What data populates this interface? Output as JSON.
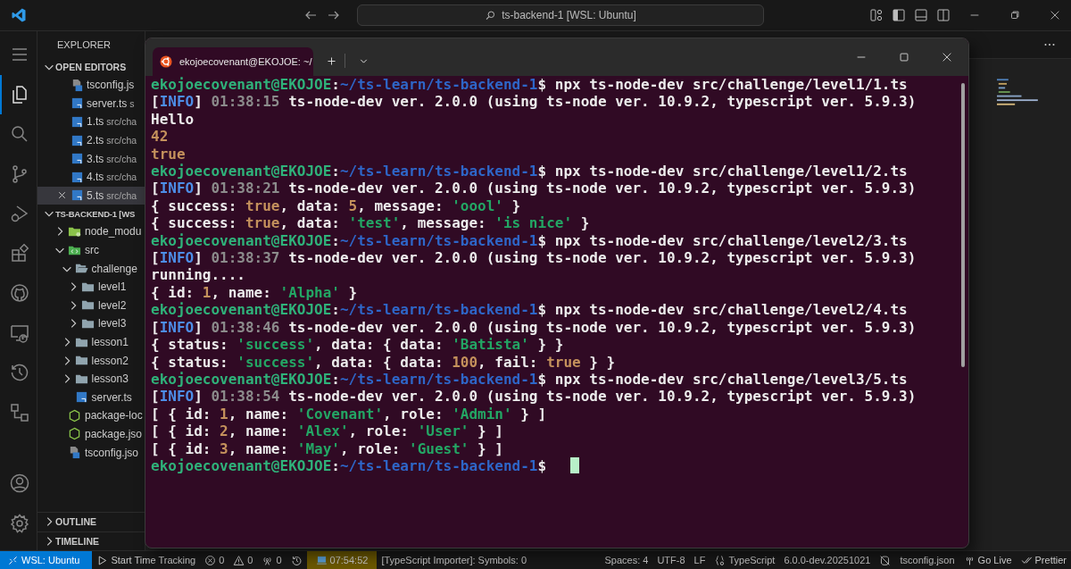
{
  "title_bar": {
    "search": "ts-backend-1 [WSL: Ubuntu]"
  },
  "activity_bar": {
    "top": [
      {
        "kind": "menu",
        "selected": false
      },
      {
        "kind": "explorer",
        "selected": true
      },
      {
        "kind": "search",
        "selected": false
      },
      {
        "kind": "source-control",
        "selected": false
      },
      {
        "kind": "run-debug",
        "selected": false
      },
      {
        "kind": "extensions",
        "selected": false
      },
      {
        "kind": "github",
        "selected": false
      },
      {
        "kind": "remote",
        "selected": false
      },
      {
        "kind": "history",
        "selected": false
      },
      {
        "kind": "tree",
        "selected": false
      }
    ],
    "bottom": [
      {
        "kind": "account",
        "selected": false
      },
      {
        "kind": "settings",
        "selected": false
      }
    ]
  },
  "sidebar": {
    "title": "EXPLORER",
    "open_editors": {
      "label": "OPEN EDITORS",
      "expanded": true,
      "items": [
        {
          "kind": "tsconfig",
          "name": "tsconfig.js",
          "selected": false
        },
        {
          "kind": "ts",
          "name": "server.ts",
          "description": "s",
          "selected": false
        },
        {
          "kind": "ts",
          "name": "1.ts",
          "description": "src/cha",
          "selected": false
        },
        {
          "kind": "ts",
          "name": "2.ts",
          "description": "src/cha",
          "selected": false
        },
        {
          "kind": "ts",
          "name": "3.ts",
          "description": "src/cha",
          "selected": false
        },
        {
          "kind": "ts",
          "name": "4.ts",
          "description": "src/cha",
          "selected": false
        },
        {
          "kind": "ts",
          "name": "5.ts",
          "description": "src/cha",
          "selected": true
        }
      ]
    },
    "workspace": {
      "label": "TS-BACKEND-1 [WS",
      "expanded": true,
      "children": [
        {
          "kind": "node-folder",
          "name": "node_modu",
          "expanded": false
        },
        {
          "kind": "src-folder",
          "name": "src",
          "expanded": true,
          "children": [
            {
              "kind": "folder",
              "name": "challenge",
              "expanded": true,
              "children": [
                {
                  "kind": "folder",
                  "name": "level1",
                  "expanded": false
                },
                {
                  "kind": "folder",
                  "name": "level2",
                  "expanded": false
                },
                {
                  "kind": "folder",
                  "name": "level3",
                  "expanded": false
                }
              ]
            },
            {
              "kind": "folder",
              "name": "lesson1",
              "expanded": false
            },
            {
              "kind": "folder",
              "name": "lesson2",
              "expanded": false
            },
            {
              "kind": "folder",
              "name": "lesson3",
              "expanded": false
            },
            {
              "kind": "ts",
              "name": "server.ts"
            }
          ]
        },
        {
          "kind": "json",
          "name": "package-loc"
        },
        {
          "kind": "json",
          "name": "package.jso"
        },
        {
          "kind": "tsconfig",
          "name": "tsconfig.jso"
        }
      ]
    },
    "outline": {
      "label": "OUTLINE",
      "expanded": false
    },
    "timeline": {
      "label": "TIMELINE",
      "expanded": false
    }
  },
  "terminal": {
    "tab_title": "ekojoecovenant@EKOJOE: ~/",
    "cursor_visible": true,
    "lines": [
      {
        "segments": [
          {
            "kind": "user",
            "text": "ekojoecovenant@EKOJOE"
          },
          {
            "kind": "text",
            "text": ":"
          },
          {
            "kind": "path",
            "text": "~/ts-learn/ts-backend-1"
          },
          {
            "kind": "text",
            "text": "$ npx ts-node-dev src/challenge/level1/1.ts"
          }
        ]
      },
      {
        "segments": [
          {
            "kind": "text",
            "text": "["
          },
          {
            "kind": "info",
            "text": "INFO"
          },
          {
            "kind": "text",
            "text": "] "
          },
          {
            "kind": "time",
            "text": "01:38:15"
          },
          {
            "kind": "text",
            "text": " ts-node-dev ver. 2.0.0 (using ts-node ver. 10.9.2, typescript ver. 5.9.3)"
          }
        ]
      },
      {
        "segments": [
          {
            "kind": "text",
            "text": "Hello"
          }
        ]
      },
      {
        "segments": [
          {
            "kind": "number",
            "text": "42"
          }
        ]
      },
      {
        "segments": [
          {
            "kind": "number",
            "text": "true"
          }
        ]
      },
      {
        "segments": [
          {
            "kind": "user",
            "text": "ekojoecovenant@EKOJOE"
          },
          {
            "kind": "text",
            "text": ":"
          },
          {
            "kind": "path",
            "text": "~/ts-learn/ts-backend-1"
          },
          {
            "kind": "text",
            "text": "$ npx ts-node-dev src/challenge/level1/2.ts"
          }
        ]
      },
      {
        "segments": [
          {
            "kind": "text",
            "text": "["
          },
          {
            "kind": "info",
            "text": "INFO"
          },
          {
            "kind": "text",
            "text": "] "
          },
          {
            "kind": "time",
            "text": "01:38:21"
          },
          {
            "kind": "text",
            "text": " ts-node-dev ver. 2.0.0 (using ts-node ver. 10.9.2, typescript ver. 5.9.3)"
          }
        ]
      },
      {
        "segments": [
          {
            "kind": "text",
            "text": "{ success: "
          },
          {
            "kind": "number",
            "text": "true"
          },
          {
            "kind": "text",
            "text": ", data: "
          },
          {
            "kind": "number",
            "text": "5"
          },
          {
            "kind": "text",
            "text": ", message: "
          },
          {
            "kind": "string",
            "text": "'oool'"
          },
          {
            "kind": "text",
            "text": " }"
          }
        ]
      },
      {
        "segments": [
          {
            "kind": "text",
            "text": "{ success: "
          },
          {
            "kind": "number",
            "text": "true"
          },
          {
            "kind": "text",
            "text": ", data: "
          },
          {
            "kind": "string",
            "text": "'test'"
          },
          {
            "kind": "text",
            "text": ", message: "
          },
          {
            "kind": "string",
            "text": "'is nice'"
          },
          {
            "kind": "text",
            "text": " }"
          }
        ]
      },
      {
        "segments": [
          {
            "kind": "user",
            "text": "ekojoecovenant@EKOJOE"
          },
          {
            "kind": "text",
            "text": ":"
          },
          {
            "kind": "path",
            "text": "~/ts-learn/ts-backend-1"
          },
          {
            "kind": "text",
            "text": "$ npx ts-node-dev src/challenge/level2/3.ts"
          }
        ]
      },
      {
        "segments": [
          {
            "kind": "text",
            "text": "["
          },
          {
            "kind": "info",
            "text": "INFO"
          },
          {
            "kind": "text",
            "text": "] "
          },
          {
            "kind": "time",
            "text": "01:38:37"
          },
          {
            "kind": "text",
            "text": " ts-node-dev ver. 2.0.0 (using ts-node ver. 10.9.2, typescript ver. 5.9.3)"
          }
        ]
      },
      {
        "segments": [
          {
            "kind": "text",
            "text": "running...."
          }
        ]
      },
      {
        "segments": [
          {
            "kind": "text",
            "text": "{ id: "
          },
          {
            "kind": "number",
            "text": "1"
          },
          {
            "kind": "text",
            "text": ", name: "
          },
          {
            "kind": "string",
            "text": "'Alpha'"
          },
          {
            "kind": "text",
            "text": " }"
          }
        ]
      },
      {
        "segments": [
          {
            "kind": "user",
            "text": "ekojoecovenant@EKOJOE"
          },
          {
            "kind": "text",
            "text": ":"
          },
          {
            "kind": "path",
            "text": "~/ts-learn/ts-backend-1"
          },
          {
            "kind": "text",
            "text": "$ npx ts-node-dev src/challenge/level2/4.ts"
          }
        ]
      },
      {
        "segments": [
          {
            "kind": "text",
            "text": "["
          },
          {
            "kind": "info",
            "text": "INFO"
          },
          {
            "kind": "text",
            "text": "] "
          },
          {
            "kind": "time",
            "text": "01:38:46"
          },
          {
            "kind": "text",
            "text": " ts-node-dev ver. 2.0.0 (using ts-node ver. 10.9.2, typescript ver. 5.9.3)"
          }
        ]
      },
      {
        "segments": [
          {
            "kind": "text",
            "text": "{ status: "
          },
          {
            "kind": "string",
            "text": "'success'"
          },
          {
            "kind": "text",
            "text": ", data: { data: "
          },
          {
            "kind": "string",
            "text": "'Batista'"
          },
          {
            "kind": "text",
            "text": " } }"
          }
        ]
      },
      {
        "segments": [
          {
            "kind": "text",
            "text": "{ status: "
          },
          {
            "kind": "string",
            "text": "'success'"
          },
          {
            "kind": "text",
            "text": ", data: { data: "
          },
          {
            "kind": "number",
            "text": "100"
          },
          {
            "kind": "text",
            "text": ", fail: "
          },
          {
            "kind": "number",
            "text": "true"
          },
          {
            "kind": "text",
            "text": " } }"
          }
        ]
      },
      {
        "segments": [
          {
            "kind": "user",
            "text": "ekojoecovenant@EKOJOE"
          },
          {
            "kind": "text",
            "text": ":"
          },
          {
            "kind": "path",
            "text": "~/ts-learn/ts-backend-1"
          },
          {
            "kind": "text",
            "text": "$ npx ts-node-dev src/challenge/level3/5.ts"
          }
        ]
      },
      {
        "segments": [
          {
            "kind": "text",
            "text": "["
          },
          {
            "kind": "info",
            "text": "INFO"
          },
          {
            "kind": "text",
            "text": "] "
          },
          {
            "kind": "time",
            "text": "01:38:54"
          },
          {
            "kind": "text",
            "text": " ts-node-dev ver. 2.0.0 (using ts-node ver. 10.9.2, typescript ver. 5.9.3)"
          }
        ]
      },
      {
        "segments": [
          {
            "kind": "text",
            "text": "[ { id: "
          },
          {
            "kind": "number",
            "text": "1"
          },
          {
            "kind": "text",
            "text": ", name: "
          },
          {
            "kind": "string",
            "text": "'Covenant'"
          },
          {
            "kind": "text",
            "text": ", role: "
          },
          {
            "kind": "string",
            "text": "'Admin'"
          },
          {
            "kind": "text",
            "text": " } ]"
          }
        ]
      },
      {
        "segments": [
          {
            "kind": "text",
            "text": "[ { id: "
          },
          {
            "kind": "number",
            "text": "2"
          },
          {
            "kind": "text",
            "text": ", name: "
          },
          {
            "kind": "string",
            "text": "'Alex'"
          },
          {
            "kind": "text",
            "text": ", role: "
          },
          {
            "kind": "string",
            "text": "'User'"
          },
          {
            "kind": "text",
            "text": " } ]"
          }
        ]
      },
      {
        "segments": [
          {
            "kind": "text",
            "text": "[ { id: "
          },
          {
            "kind": "number",
            "text": "3"
          },
          {
            "kind": "text",
            "text": ", name: "
          },
          {
            "kind": "string",
            "text": "'May'"
          },
          {
            "kind": "text",
            "text": ", role: "
          },
          {
            "kind": "string",
            "text": "'Guest'"
          },
          {
            "kind": "text",
            "text": " } ]"
          }
        ]
      },
      {
        "segments": [
          {
            "kind": "user",
            "text": "ekojoecovenant@EKOJOE"
          },
          {
            "kind": "text",
            "text": ":"
          },
          {
            "kind": "path",
            "text": "~/ts-learn/ts-backend-1"
          },
          {
            "kind": "text",
            "text": "$"
          }
        ]
      }
    ]
  },
  "status_bar": {
    "left": [
      {
        "kind": "remote",
        "text": "WSL: Ubuntu"
      },
      {
        "kind": "play",
        "text": "Start Time Tracking"
      },
      {
        "kind": "errors",
        "text": "0"
      },
      {
        "kind": "warnings",
        "text": "0"
      },
      {
        "kind": "ports",
        "text": "0"
      },
      {
        "kind": "history"
      },
      {
        "kind": "timer",
        "text": "07:54:52"
      },
      {
        "kind": "plain",
        "text": "[TypeScript Importer]: Symbols: 0"
      }
    ],
    "right": [
      {
        "kind": "plain",
        "text": "Spaces: 4"
      },
      {
        "kind": "plain",
        "text": "UTF-8"
      },
      {
        "kind": "plain",
        "text": "LF"
      },
      {
        "kind": "language",
        "text": "TypeScript"
      },
      {
        "kind": "plain",
        "text": "6.0.0-dev.20251021"
      },
      {
        "kind": "copilot"
      },
      {
        "kind": "plain",
        "text": "tsconfig.json"
      },
      {
        "kind": "live",
        "text": "Go Live"
      },
      {
        "kind": "prettier",
        "text": "Prettier"
      }
    ]
  }
}
